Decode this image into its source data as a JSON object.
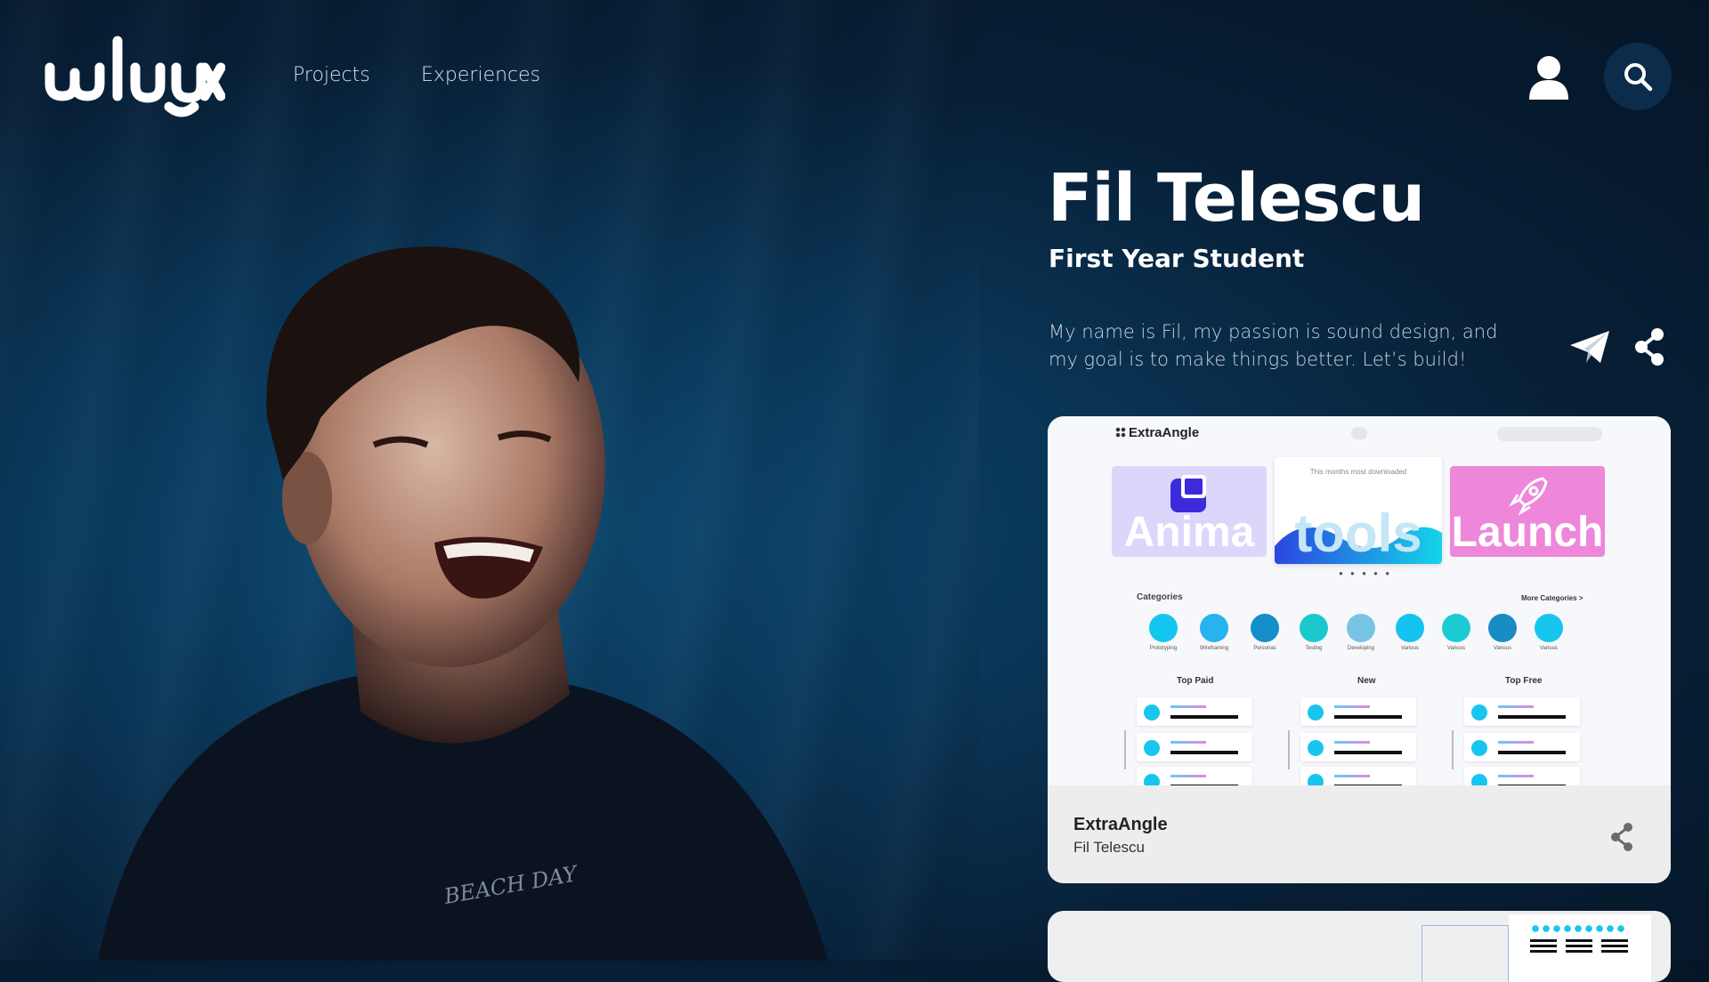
{
  "brand": {
    "logo_text": "wluux"
  },
  "nav": {
    "items": [
      {
        "label": "Projects"
      },
      {
        "label": "Experiences"
      }
    ]
  },
  "profile": {
    "name": "Fil Telescu",
    "role": "First Year Student",
    "bio": "My name is Fil, my passion is sound design, and my goal is to make things better. Let’s build!",
    "shirt_text": "BEACH DAY"
  },
  "project_card": {
    "title": "ExtraAngle",
    "author": "Fil Telescu",
    "preview": {
      "app_name": "ExtraAngle",
      "banners": [
        {
          "label": "Anima"
        },
        {
          "label": "tools",
          "caption": "This months most downloaded"
        },
        {
          "label": "Launch"
        }
      ],
      "categories_title": "Categories",
      "more_categories": "More Categories >",
      "categories": [
        "Prototyping",
        "Wireframing",
        "Personas",
        "Testing",
        "Developing",
        "Various",
        "Various",
        "Various",
        "Various"
      ],
      "columns": [
        "Top Paid",
        "New",
        "Top Free"
      ]
    }
  },
  "colors": {
    "accent": "#0c2c4c",
    "background": "#071f36",
    "card_bg": "#ededee",
    "category_cyan": "#17c6ef"
  },
  "icons": {
    "user": "user-icon",
    "search": "search-icon",
    "send": "paper-plane-icon",
    "share": "share-icon"
  }
}
